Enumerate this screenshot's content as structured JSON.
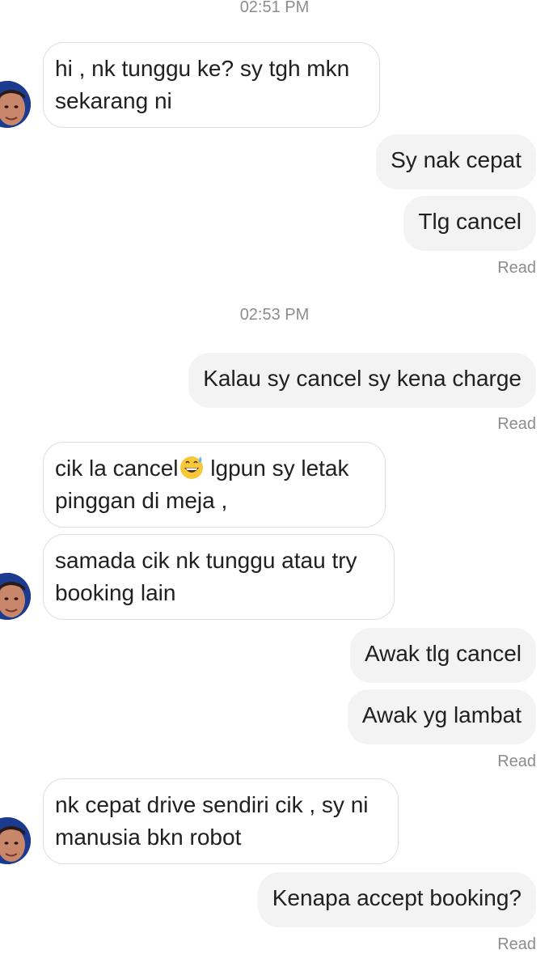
{
  "chat": {
    "timestamps": [
      "02:51 PM",
      "02:53 PM"
    ],
    "read_label": "Read",
    "messages": [
      {
        "from": "driver",
        "text": "hi , nk tunggu ke? sy tgh mkn\nsekarang ni"
      },
      {
        "from": "me",
        "text": "Sy nak cepat"
      },
      {
        "from": "me",
        "text": "Tlg cancel"
      },
      {
        "from": "me",
        "text": "Kalau sy cancel sy kena charge"
      },
      {
        "from": "driver",
        "text_before_emoji": "cik la cancel",
        "emoji": "grinning-sweat-emoji",
        "text_after_emoji": " lgpun sy letak\npinggan di meja ,"
      },
      {
        "from": "driver",
        "text": "samada cik nk tunggu atau try\nbooking lain"
      },
      {
        "from": "me",
        "text": "Awak tlg cancel"
      },
      {
        "from": "me",
        "text": "Awak yg lambat"
      },
      {
        "from": "driver",
        "text": "nk cepat drive sendiri cik , sy ni\nmanusia bkn robot"
      },
      {
        "from": "me",
        "text": "Kenapa accept booking?"
      }
    ]
  },
  "colors": {
    "incoming_bubble": "#ffffff",
    "outgoing_bubble": "#f3f3f3",
    "meta_text": "#8c8c8c",
    "avatar_bg": "#1a3b8f"
  }
}
